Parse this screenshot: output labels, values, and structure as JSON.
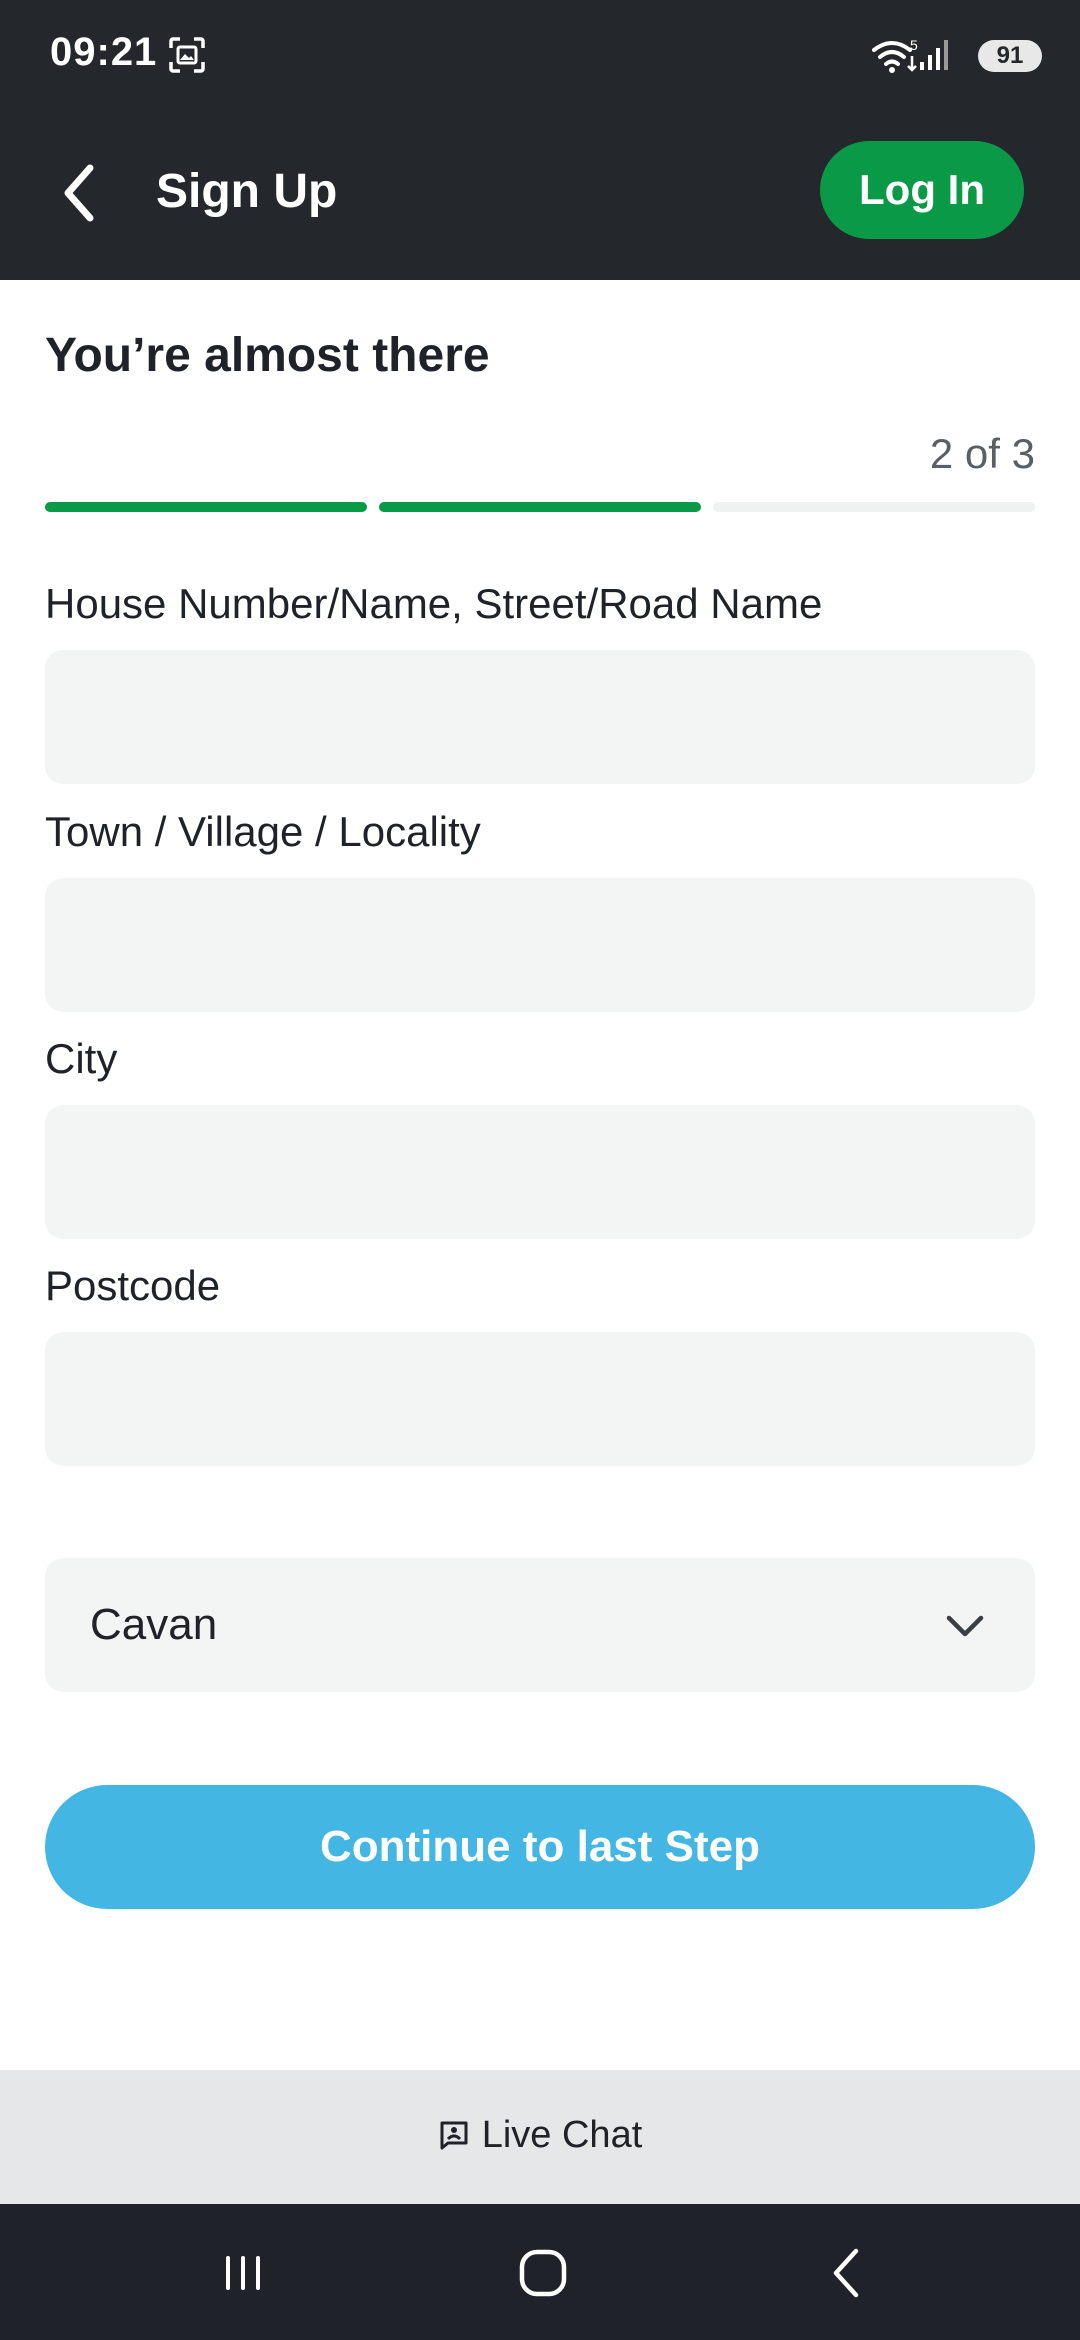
{
  "status_bar": {
    "time": "09:21",
    "battery": "91",
    "wifi_badge": "5"
  },
  "app_bar": {
    "title": "Sign Up",
    "login_label": "Log In"
  },
  "form": {
    "heading": "You’re almost there",
    "step_text": "2 of 3",
    "progress": {
      "current_step": 2,
      "total_steps": 3
    },
    "fields": {
      "street": {
        "label": "House Number/Name, Street/Road Name",
        "value": ""
      },
      "town": {
        "label": "Town / Village / Locality",
        "value": ""
      },
      "city": {
        "label": "City",
        "value": ""
      },
      "postcode": {
        "label": "Postcode",
        "value": ""
      }
    },
    "county_select": {
      "selected": "Cavan"
    },
    "continue_label": "Continue to last Step"
  },
  "live_chat": {
    "label": "Live Chat"
  },
  "colors": {
    "header_bg": "#24272b",
    "brand_green": "#0a9a47",
    "continue_blue": "#43b6e4",
    "input_bg": "#f3f4f4"
  },
  "icons": {
    "back": "chevron-left-icon",
    "dropdown": "chevron-down-icon",
    "chat": "chat-icon",
    "nav_recents": "recents-icon",
    "nav_home": "home-icon",
    "nav_back": "nav-back-icon"
  }
}
